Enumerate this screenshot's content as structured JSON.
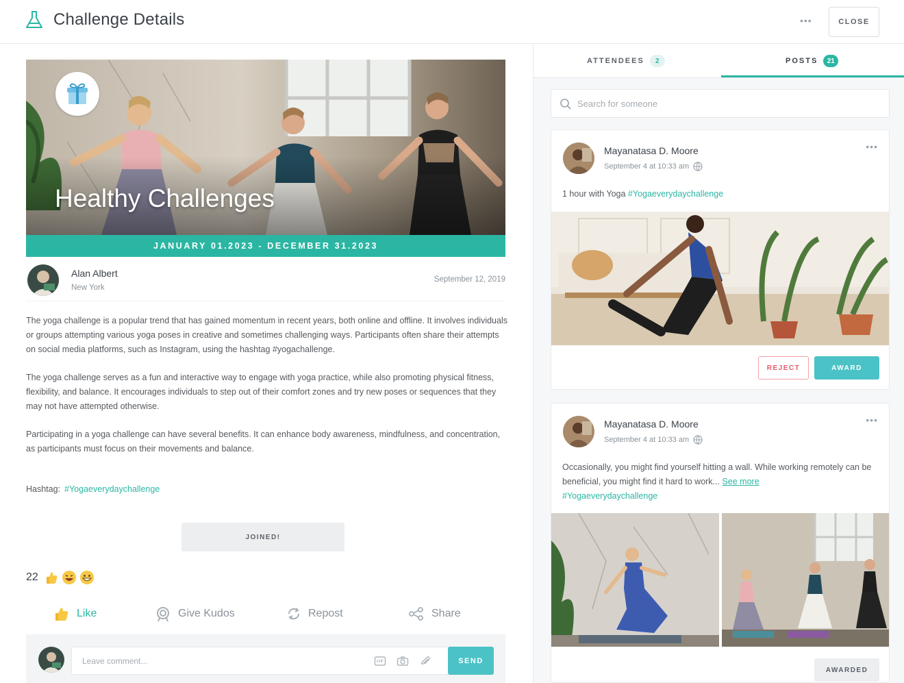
{
  "header": {
    "title": "Challenge Details",
    "more_label": "•••",
    "close_label": "CLOSE",
    "logo_icon": "flask-icon"
  },
  "challenge": {
    "banner_title": "Healthy Challenges",
    "banner_icon": "gift-icon",
    "date_range": "JANUARY 01.2023 - DECEMBER 31.2023",
    "author": {
      "name": "Alan Albert",
      "location": "New York",
      "date": "September 12, 2019"
    },
    "paragraphs": [
      "The yoga challenge is a popular trend that has gained momentum in recent years, both online and offline. It involves individuals or groups attempting various yoga poses in creative and sometimes challenging ways. Participants often share their attempts on social media platforms, such as Instagram, using the hashtag #yogachallenge.",
      "The yoga challenge serves as a fun and interactive way to engage with yoga practice, while also promoting physical fitness, flexibility, and balance. It encourages individuals to step out of their comfort zones and try new poses or sequences that they may not have attempted otherwise.",
      "Participating in a yoga challenge can have several benefits. It can enhance body awareness, mindfulness, and concentration, as participants must focus on their movements and balance."
    ],
    "hashtag_label": "Hashtag:",
    "hashtag": "#Yogaeverydaychallenge",
    "joined_label": "JOINED!",
    "reaction_count": "22",
    "actions": {
      "like": "Like",
      "kudos": "Give Kudos",
      "repost": "Repost",
      "share": "Share"
    },
    "comment_placeholder": "Leave comment...",
    "send_label": "SEND"
  },
  "tabs": {
    "attendees_label": "ATTENDEES",
    "attendees_count": "2",
    "posts_label": "POSTS",
    "posts_count": "21",
    "active": "posts"
  },
  "search": {
    "placeholder": "Search for someone"
  },
  "posts": [
    {
      "author": "Mayanatasa D. Moore",
      "meta": "September 4 at 10:33 am",
      "text": "1 hour with Yoga ",
      "hashtag": "#Yogaeverydaychallenge",
      "reject_label": "REJECT",
      "award_label": "AWARD"
    },
    {
      "author": "Mayanatasa D. Moore",
      "meta": "September 4 at 10:33 am",
      "text": "Occasionally, you might find yourself hitting a wall. While working remotely can be beneficial, you might find it hard to work... ",
      "see_more": "See more",
      "hashtag": "#Yogaeverydaychallenge",
      "awarded_label": "AWARDED"
    }
  ],
  "colors": {
    "accent": "#2bb6a3",
    "button_teal": "#4bc2c6",
    "reject": "#e25b66"
  }
}
